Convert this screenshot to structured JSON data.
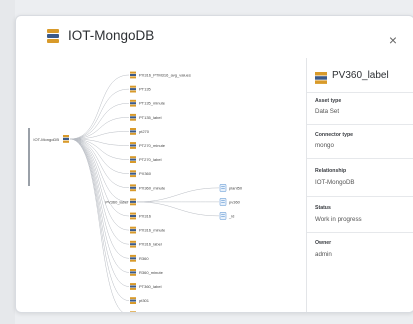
{
  "dialog": {
    "title": "IOT-MongoDB",
    "close_symbol": "×",
    "title_icon": "database-icon"
  },
  "graph": {
    "root": {
      "label": "IOT-MongoDB",
      "icon": "database-icon"
    },
    "table_icon": "table-icon",
    "field_icon": "field-icon",
    "children": [
      "PX316_PTM316_avg_values",
      "PT135",
      "PT135_minute",
      "PT135_label",
      "pt270",
      "PT270_minute",
      "PT270_label",
      "PX360",
      "PX360_minute",
      "PV360_label",
      "PX316",
      "PX316_minute",
      "PX316_label",
      "R360",
      "R360_minute",
      "PT360_label",
      "pt301",
      "PT301_minute"
    ],
    "selected_child": "PV360_label",
    "selected_fields": [
      "plant50",
      "pv360",
      "_id"
    ]
  },
  "panel": {
    "title": "PV360_label",
    "fields": [
      {
        "label": "Asset type",
        "value": "Data Set"
      },
      {
        "label": "Connector type",
        "value": "mongo"
      },
      {
        "label": "Relationship",
        "value": "IOT-MongoDB"
      },
      {
        "label": "Status",
        "value": "Work in progress"
      },
      {
        "label": "Owner",
        "value": "admin"
      }
    ]
  },
  "colors": {
    "table_icon": "#d89a2a",
    "table_icon_dark": "#3b5a8a",
    "field_icon": "#6fa1d8",
    "edge": "#b8bcc3"
  }
}
